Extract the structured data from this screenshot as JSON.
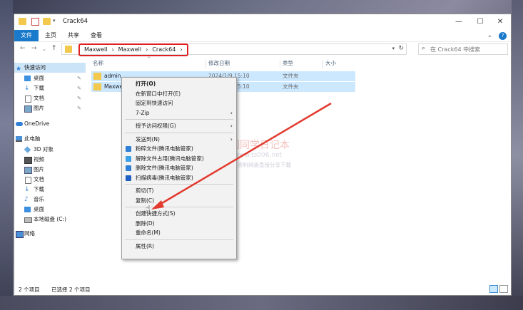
{
  "window": {
    "title": "Crack64",
    "controls": {
      "minimize": "—",
      "maximize": "☐",
      "close": "✕"
    }
  },
  "ribbon": {
    "tabs": [
      {
        "label": "文件",
        "active": true
      },
      {
        "label": "主页",
        "active": false
      },
      {
        "label": "共享",
        "active": false
      },
      {
        "label": "查看",
        "active": false
      }
    ],
    "expand_glyph": "⌄",
    "help_glyph": "?"
  },
  "nav": {
    "back": "←",
    "forward": "→",
    "recent": "⌄",
    "up": "↑",
    "breadcrumbs": [
      "Maxwell",
      "Maxwell",
      "Crack64"
    ],
    "separator": "›",
    "search_placeholder": "在 Crack64 中搜索"
  },
  "sidebar": {
    "items": [
      {
        "label": "快速访问",
        "icon": "star-icon",
        "level": 0,
        "selected": true
      },
      {
        "label": "桌面",
        "icon": "desktop-icon",
        "level": 1,
        "pinned": true
      },
      {
        "label": "下载",
        "icon": "download-icon",
        "level": 1,
        "pinned": true
      },
      {
        "label": "文档",
        "icon": "document-icon",
        "level": 1,
        "pinned": true
      },
      {
        "label": "图片",
        "icon": "picture-icon",
        "level": 1,
        "pinned": true
      },
      {
        "label": "OneDrive",
        "icon": "cloud-icon",
        "level": 0
      },
      {
        "label": "此电脑",
        "icon": "computer-icon",
        "level": 0
      },
      {
        "label": "3D 对象",
        "icon": "cube-icon",
        "level": 1
      },
      {
        "label": "视频",
        "icon": "video-icon",
        "level": 1
      },
      {
        "label": "图片",
        "icon": "picture-icon",
        "level": 1
      },
      {
        "label": "文档",
        "icon": "document-icon",
        "level": 1
      },
      {
        "label": "下载",
        "icon": "download-icon",
        "level": 1
      },
      {
        "label": "音乐",
        "icon": "music-icon",
        "level": 1
      },
      {
        "label": "桌面",
        "icon": "desktop-icon",
        "level": 1
      },
      {
        "label": "本地磁盘 (C:)",
        "icon": "drive-icon",
        "level": 1
      },
      {
        "label": "网络",
        "icon": "network-icon",
        "level": 0
      }
    ]
  },
  "columns": [
    "名称",
    "修改日期",
    "类型",
    "大小"
  ],
  "files": [
    {
      "name": "admin",
      "date": "2024/1/9 15:10",
      "type": "文件夹"
    },
    {
      "name": "Maxwell",
      "date": "2024/1/9 15:10",
      "type": "文件夹"
    }
  ],
  "context_menu": {
    "items": [
      {
        "label": "打开(O)",
        "bold": true
      },
      {
        "label": "在新窗口中打开(E)"
      },
      {
        "label": "固定到快速访问"
      },
      {
        "label": "7-Zip",
        "submenu": true
      },
      {
        "sep": true
      },
      {
        "label": "授予访问权限(G)",
        "submenu": true
      },
      {
        "sep": true
      },
      {
        "label": "发送到(N)",
        "submenu": true
      },
      {
        "label": "粉碎文件(腾讯电脑管家)",
        "icon": "shred-icon",
        "color": "#2f7fd6"
      },
      {
        "label": "解除文件占用(腾讯电脑管家)",
        "icon": "unlock-icon",
        "color": "#3aa0e8"
      },
      {
        "label": "删除文件(腾讯电脑管家)",
        "icon": "delete-icon",
        "color": "#2f7fd6"
      },
      {
        "label": "扫描病毒(腾讯电脑管家)",
        "icon": "shield-icon",
        "color": "#1f5fc4"
      },
      {
        "sep": true
      },
      {
        "label": "剪切(T)"
      },
      {
        "label": "复制(C)"
      },
      {
        "sep": true
      },
      {
        "label": "创建快捷方式(S)"
      },
      {
        "label": "删除(D)"
      },
      {
        "label": "重命名(M)"
      },
      {
        "sep": true
      },
      {
        "label": "属性(R)"
      }
    ]
  },
  "status": {
    "count": "2 个项目",
    "selected": "已选择 2 个项目"
  },
  "watermark": {
    "title": "门同学日记本",
    "url": "www.ts006.net",
    "tagline": "软件、资源、资料网盘直接分享下载"
  },
  "colors": {
    "accent": "#1979ca",
    "selection": "#cce8ff",
    "highlight_border": "#e02020",
    "arrow": "#e23a2e"
  }
}
